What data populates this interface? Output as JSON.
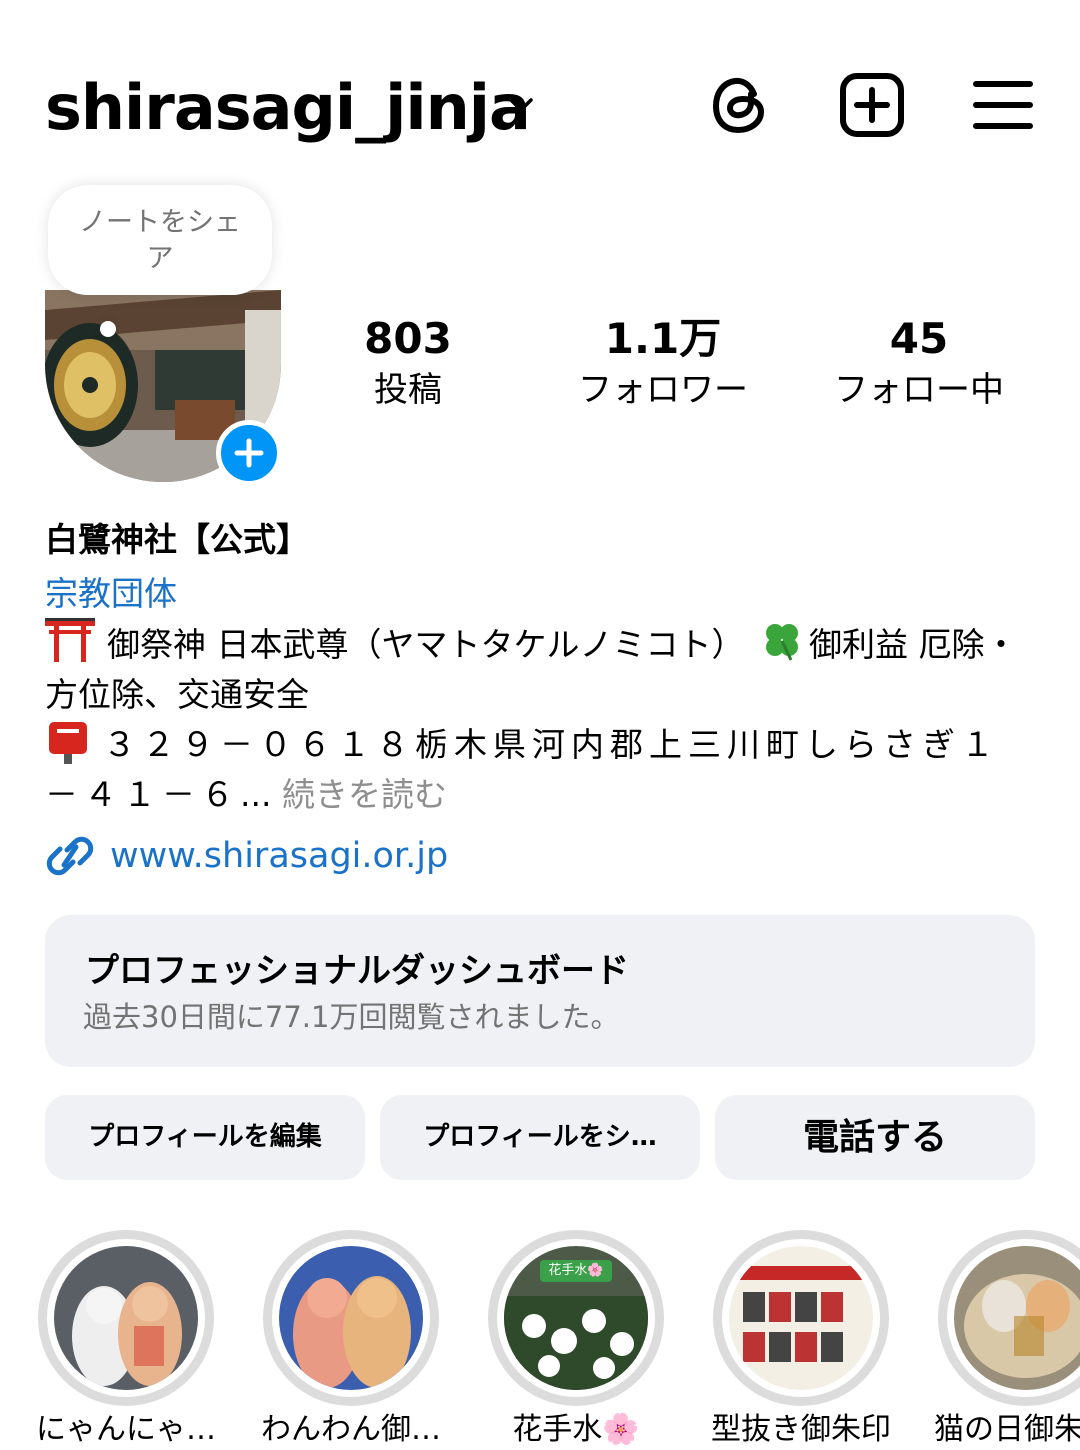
{
  "header": {
    "username": "shirasagi_jinja",
    "icons": [
      "threads-icon",
      "create-post-icon",
      "menu-icon"
    ]
  },
  "note": {
    "text": "ノートをシェア"
  },
  "stats": {
    "posts": {
      "value": "803",
      "label": "投稿"
    },
    "followers": {
      "value": "1.1万",
      "label": "フォロワー"
    },
    "following": {
      "value": "45",
      "label": "フォロー中"
    }
  },
  "profile": {
    "display_name": "白鷺神社【公式】",
    "category": "宗教団体",
    "bio_line1_a": "御祭神 日本武尊（ヤマトタケルノミコト）",
    "bio_line1_b": "御利益 厄除・方位除、交通安全",
    "bio_line2": "３２９－０６１８栃木県河内郡上三川町しらさぎ１－４１－６",
    "bio_ellipsis": "...",
    "more": "続きを読む",
    "website": "www.shirasagi.or.jp"
  },
  "dashboard": {
    "title": "プロフェッショナルダッシュボード",
    "subtitle": "過去30日間に77.1万回閲覧されました。"
  },
  "actions": {
    "edit": "プロフィールを編集",
    "share": "プロフィールをシ…",
    "call": "電話する"
  },
  "highlights": [
    {
      "label": "にゃんにゃ…"
    },
    {
      "label": "わんわん御…"
    },
    {
      "label": "花手水🌸"
    },
    {
      "label": "型抜き御朱印"
    },
    {
      "label": "猫の日御朱"
    }
  ],
  "highlight_badge": "花手水🌸",
  "colors": {
    "link": "#1a72c9",
    "accent": "#0095f6",
    "card": "#f0f1f4",
    "muted": "#737373"
  }
}
